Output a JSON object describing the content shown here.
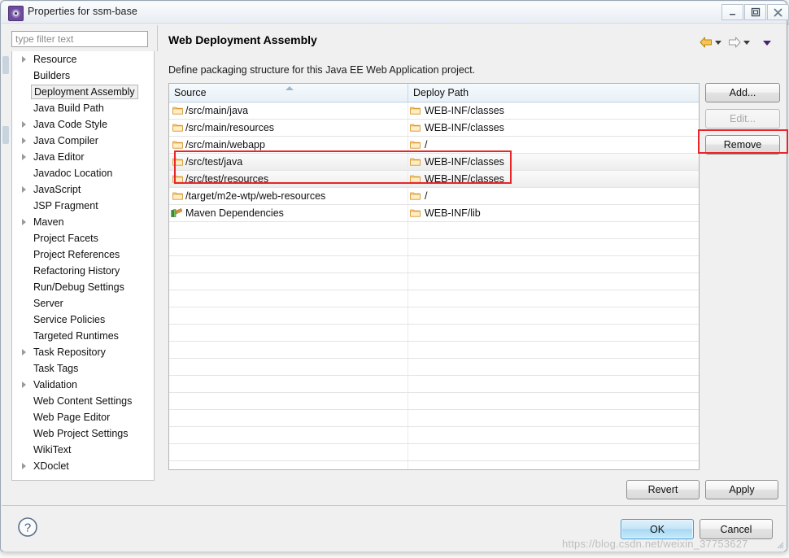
{
  "window": {
    "title": "Properties for ssm-base",
    "icon": "gear-icon",
    "minimize_label": "–",
    "maximize_label": "□",
    "close_label": "✕"
  },
  "filter": {
    "placeholder": "type filter text",
    "value": ""
  },
  "sidebar": {
    "items": [
      {
        "label": "Resource",
        "expandable": true,
        "selected": false
      },
      {
        "label": "Builders",
        "expandable": false,
        "selected": false
      },
      {
        "label": "Deployment Assembly",
        "expandable": false,
        "selected": true
      },
      {
        "label": "Java Build Path",
        "expandable": false,
        "selected": false
      },
      {
        "label": "Java Code Style",
        "expandable": true,
        "selected": false
      },
      {
        "label": "Java Compiler",
        "expandable": true,
        "selected": false
      },
      {
        "label": "Java Editor",
        "expandable": true,
        "selected": false
      },
      {
        "label": "Javadoc Location",
        "expandable": false,
        "selected": false
      },
      {
        "label": "JavaScript",
        "expandable": true,
        "selected": false
      },
      {
        "label": "JSP Fragment",
        "expandable": false,
        "selected": false
      },
      {
        "label": "Maven",
        "expandable": true,
        "selected": false
      },
      {
        "label": "Project Facets",
        "expandable": false,
        "selected": false
      },
      {
        "label": "Project References",
        "expandable": false,
        "selected": false
      },
      {
        "label": "Refactoring History",
        "expandable": false,
        "selected": false
      },
      {
        "label": "Run/Debug Settings",
        "expandable": false,
        "selected": false
      },
      {
        "label": "Server",
        "expandable": false,
        "selected": false
      },
      {
        "label": "Service Policies",
        "expandable": false,
        "selected": false
      },
      {
        "label": "Targeted Runtimes",
        "expandable": false,
        "selected": false
      },
      {
        "label": "Task Repository",
        "expandable": true,
        "selected": false
      },
      {
        "label": "Task Tags",
        "expandable": false,
        "selected": false
      },
      {
        "label": "Validation",
        "expandable": true,
        "selected": false
      },
      {
        "label": "Web Content Settings",
        "expandable": false,
        "selected": false
      },
      {
        "label": "Web Page Editor",
        "expandable": false,
        "selected": false
      },
      {
        "label": "Web Project Settings",
        "expandable": false,
        "selected": false
      },
      {
        "label": "WikiText",
        "expandable": false,
        "selected": false
      },
      {
        "label": "XDoclet",
        "expandable": true,
        "selected": false
      }
    ]
  },
  "page": {
    "title": "Web Deployment Assembly",
    "description": "Define packaging structure for this Java EE Web Application project.",
    "nav_back_icon": "back-arrow-icon",
    "nav_forward_icon": "forward-arrow-icon",
    "menu_caret_icon": "chevron-down-icon"
  },
  "table": {
    "columns": [
      "Source",
      "Deploy Path"
    ],
    "sort_column": "Source",
    "sort_direction": "ascending",
    "rows": [
      {
        "source": "/src/main/java",
        "deploy": "WEB-INF/classes",
        "icon": "folder-icon",
        "selected": false
      },
      {
        "source": "/src/main/resources",
        "deploy": "WEB-INF/classes",
        "icon": "folder-icon",
        "selected": false
      },
      {
        "source": "/src/main/webapp",
        "deploy": "/",
        "icon": "folder-icon",
        "selected": false
      },
      {
        "source": "/src/test/java",
        "deploy": "WEB-INF/classes",
        "icon": "folder-icon",
        "selected": true
      },
      {
        "source": "/src/test/resources",
        "deploy": "WEB-INF/classes",
        "icon": "folder-icon",
        "selected": true
      },
      {
        "source": "/target/m2e-wtp/web-resources",
        "deploy": "/",
        "icon": "folder-icon",
        "selected": false
      },
      {
        "source": "Maven Dependencies",
        "deploy": "WEB-INF/lib",
        "icon": "library-icon",
        "selected": false
      }
    ],
    "empty_row_count": 16
  },
  "side_buttons": {
    "add": "Add...",
    "edit": "Edit...",
    "remove": "Remove",
    "edit_disabled": true,
    "remove_highlighted": true
  },
  "bottom_buttons": {
    "revert": "Revert",
    "apply": "Apply",
    "ok": "OK",
    "cancel": "Cancel"
  },
  "help": {
    "icon": "help-question-icon",
    "label": "?"
  },
  "highlight": {
    "color": "#e8262a"
  },
  "watermark": {
    "text": "https://blog.csdn.net/weixin_37753627"
  }
}
